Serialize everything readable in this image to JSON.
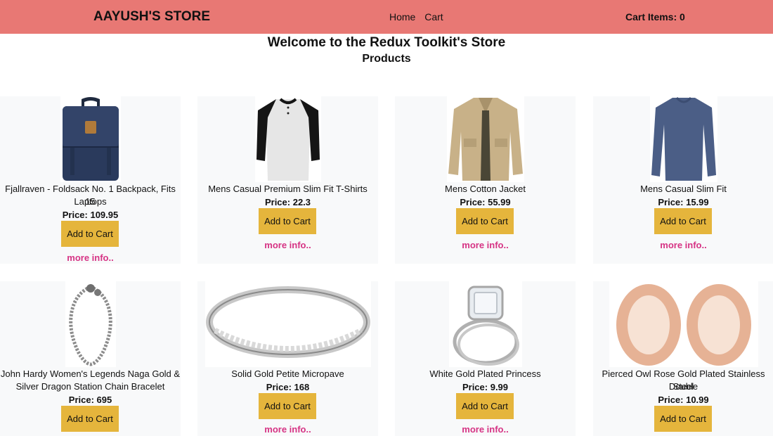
{
  "navbar": {
    "brand": "AAYUSH'S STORE",
    "links": [
      "Home",
      "Cart"
    ],
    "cart_items": "Cart Items: 0"
  },
  "header": {
    "welcome": "Welcome to the Redux Toolkit's Store",
    "subtitle": "Products"
  },
  "products": [
    {
      "title_line1": "Fjallraven - Foldsack No. 1 Backpack, Fits 15",
      "title_line2": "Laptops",
      "price": "Price: 109.95",
      "button": "Add to Cart",
      "more": "more info..",
      "image": "backpack-image"
    },
    {
      "title_line1": "Mens Casual Premium Slim Fit T-Shirts",
      "title_line2": "",
      "price": "Price: 22.3",
      "button": "Add to Cart",
      "more": "more info..",
      "image": "tshirt-image"
    },
    {
      "title_line1": "Mens Cotton Jacket",
      "title_line2": "",
      "price": "Price: 55.99",
      "button": "Add to Cart",
      "more": "more info..",
      "image": "jacket-image"
    },
    {
      "title_line1": "Mens Casual Slim Fit",
      "title_line2": "",
      "price": "Price: 15.99",
      "button": "Add to Cart",
      "more": "more info..",
      "image": "longsleeve-image"
    },
    {
      "title_line1": "John Hardy Women's Legends Naga Gold &",
      "title_line2": "Silver Dragon Station Chain Bracelet",
      "price": "Price: 695",
      "button": "Add to Cart",
      "more": "",
      "image": "bracelet-image"
    },
    {
      "title_line1": "Solid Gold Petite Micropave",
      "title_line2": "",
      "price": "Price: 168",
      "button": "Add to Cart",
      "more": "more info..",
      "image": "ring-image"
    },
    {
      "title_line1": "White Gold Plated Princess",
      "title_line2": "",
      "price": "Price: 9.99",
      "button": "Add to Cart",
      "more": "more info..",
      "image": "princess-ring-image"
    },
    {
      "title_line1": "Pierced Owl Rose Gold Plated Stainless Steel",
      "title_line2": "Double",
      "price": "Price: 10.99",
      "button": "Add to Cart",
      "more": "",
      "image": "plugs-image"
    }
  ],
  "colors": {
    "navbar": "#e87874",
    "button": "#e5b53c",
    "link": "#d63384",
    "card": "#f8f9fa"
  }
}
